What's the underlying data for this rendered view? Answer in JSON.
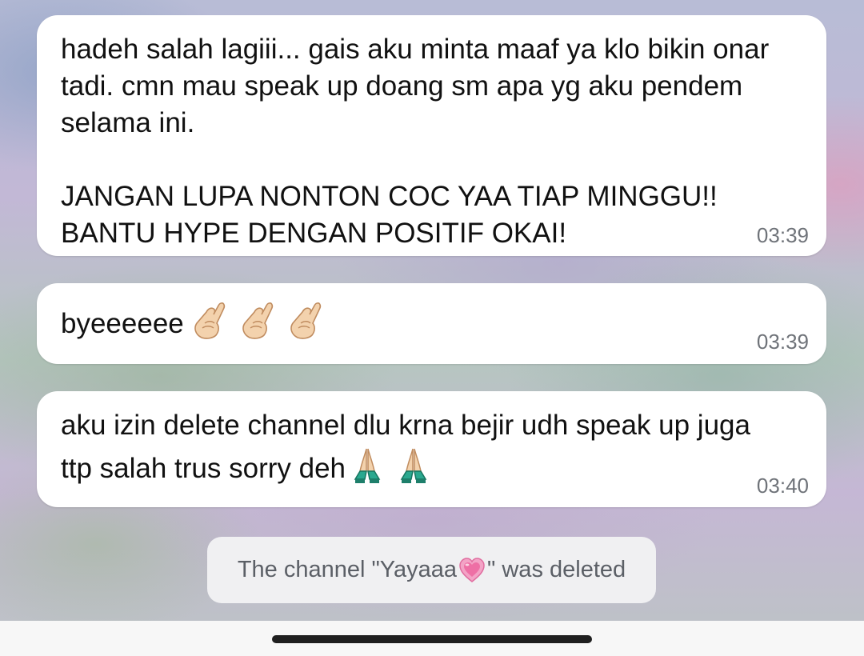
{
  "messages": [
    {
      "line1": "hadeh salah lagiii... gais aku minta maaf ya klo bikin onar",
      "line2": "tadi. cmn mau speak up doang sm apa yg aku pendem",
      "line3": "selama ini.",
      "line4": "JANGAN LUPA NONTON COC YAA TIAP MINGGU!!",
      "line5": "BANTU HYPE DENGAN POSITIF OKAI!",
      "time": "03:39"
    },
    {
      "text": "byeeeeee",
      "emoji": [
        "crossed-fingers",
        "crossed-fingers",
        "crossed-fingers"
      ],
      "time": "03:39"
    },
    {
      "line1": "aku izin delete channel dlu krna bejir udh speak up juga",
      "line2": "ttp salah trus sorry deh",
      "emoji": [
        "folded-hands",
        "folded-hands"
      ],
      "time": "03:40"
    }
  ],
  "service_message": {
    "prefix": "The channel \"Yayaaa",
    "suffix": "\" was deleted",
    "emoji": "growing-heart"
  },
  "colors": {
    "bubble": "#ffffff",
    "time": "#6f7379",
    "service_bg": "#f0f0f2",
    "service_text": "#5b5f66"
  }
}
